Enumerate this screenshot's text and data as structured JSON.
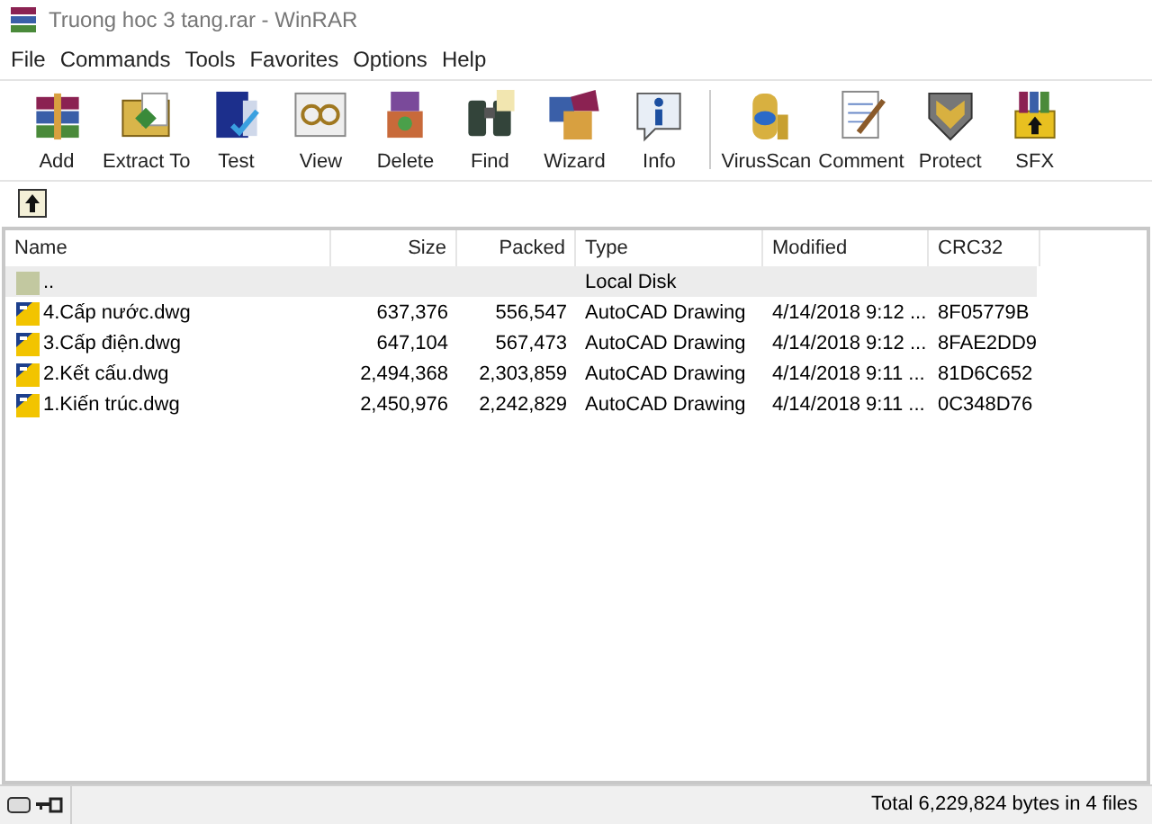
{
  "window": {
    "title": "Truong hoc 3 tang.rar - WinRAR"
  },
  "menu": [
    "File",
    "Commands",
    "Tools",
    "Favorites",
    "Options",
    "Help"
  ],
  "toolbar": [
    {
      "label": "Add"
    },
    {
      "label": "Extract To"
    },
    {
      "label": "Test"
    },
    {
      "label": "View"
    },
    {
      "label": "Delete"
    },
    {
      "label": "Find"
    },
    {
      "label": "Wizard"
    },
    {
      "label": "Info"
    },
    {
      "label": "VirusScan",
      "separator_before": true
    },
    {
      "label": "Comment"
    },
    {
      "label": "Protect"
    },
    {
      "label": "SFX"
    }
  ],
  "table": {
    "columns": [
      "Name",
      "Size",
      "Packed",
      "Type",
      "Modified",
      "CRC32"
    ],
    "rows": [
      {
        "kind": "parent",
        "selected": true,
        "cells": [
          "..",
          "",
          "",
          "Local Disk",
          "",
          ""
        ]
      },
      {
        "kind": "file",
        "selected": false,
        "cells": [
          "4.Cấp nước.dwg",
          "637,376",
          "556,547",
          "AutoCAD Drawing",
          "4/14/2018 9:12 ...",
          "8F05779B"
        ]
      },
      {
        "kind": "file",
        "selected": false,
        "cells": [
          "3.Cấp điện.dwg",
          "647,104",
          "567,473",
          "AutoCAD Drawing",
          "4/14/2018 9:12 ...",
          "8FAE2DD9"
        ]
      },
      {
        "kind": "file",
        "selected": false,
        "cells": [
          "2.Kết cấu.dwg",
          "2,494,368",
          "2,303,859",
          "AutoCAD Drawing",
          "4/14/2018 9:11 ...",
          "81D6C652"
        ]
      },
      {
        "kind": "file",
        "selected": false,
        "cells": [
          "1.Kiến trúc.dwg",
          "2,450,976",
          "2,242,829",
          "AutoCAD Drawing",
          "4/14/2018 9:11 ...",
          "0C348D76"
        ]
      }
    ]
  },
  "status_bar": {
    "text": "Total 6,229,824 bytes in 4 files"
  }
}
